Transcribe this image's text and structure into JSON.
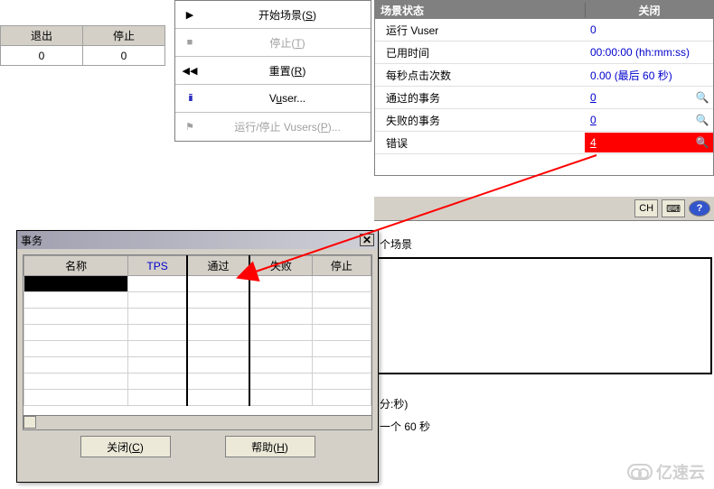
{
  "top_left": {
    "headers": [
      "退出",
      "停止"
    ],
    "values": [
      "0",
      "0"
    ]
  },
  "actions": {
    "start": "开始场景(S)",
    "stop": "停止(T)",
    "reset": "重置(R)",
    "vuser": "Vuser...",
    "runstop": "运行/停止 Vusers(P)..."
  },
  "status": {
    "title_left": "场景状态",
    "title_right": "关闭",
    "rows": {
      "running_vuser_label": "运行 Vuser",
      "running_vuser_val": "0",
      "elapsed_label": "已用时间",
      "elapsed_val": "00:00:00 (hh:mm:ss)",
      "hits_label": "每秒点击次数",
      "hits_val": "0.00 (最后 60 秒)",
      "passed_label": "通过的事务",
      "passed_val": "0",
      "failed_label": "失败的事务",
      "failed_val": "0",
      "error_label": "错误",
      "error_val": "4"
    }
  },
  "toolstrip": {
    "ch": "CH"
  },
  "scene": {
    "group_title": "个场景",
    "axis_note": "分:秒)",
    "tick_note": "一个 60 秒"
  },
  "tx_dialog": {
    "title": "事务",
    "headers": [
      "名称",
      "TPS",
      "通过",
      "失败",
      "停止"
    ],
    "close_btn": "关闭(C)",
    "help_btn": "帮助(H)"
  },
  "watermark": "亿速云",
  "chart_data": {
    "type": "table",
    "title": "场景状态",
    "series": [
      {
        "name": "运行 Vuser",
        "values": [
          0
        ]
      },
      {
        "name": "已用时间",
        "values": [
          "00:00:00"
        ]
      },
      {
        "name": "每秒点击次数",
        "values": [
          0.0
        ]
      },
      {
        "name": "通过的事务",
        "values": [
          0
        ]
      },
      {
        "name": "失败的事务",
        "values": [
          0
        ]
      },
      {
        "name": "错误",
        "values": [
          4
        ]
      }
    ]
  }
}
